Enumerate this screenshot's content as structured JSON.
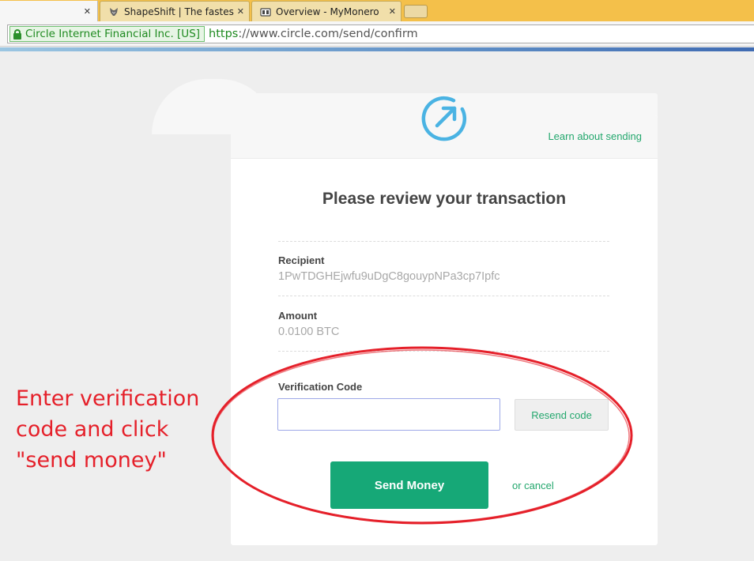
{
  "browser": {
    "tabs": [
      {
        "title": "",
        "active": true
      },
      {
        "title": "ShapeShift | The fastest wa",
        "active": false
      },
      {
        "title": "Overview - MyMonero",
        "active": false
      }
    ],
    "close_glyph": "✕",
    "ev_certificate": "Circle Internet Financial Inc. [US]",
    "url_scheme": "https",
    "url_rest": "://www.circle.com/send/confirm"
  },
  "page": {
    "learn_link": "Learn about sending",
    "title": "Please review your transaction",
    "recipient": {
      "label": "Recipient",
      "value": "1PwTDGHEjwfu9uDgC8gouypNPa3cp7Ipfc"
    },
    "amount": {
      "label": "Amount",
      "value": "0.0100 BTC"
    },
    "verification": {
      "label": "Verification Code",
      "value": "",
      "placeholder": ""
    },
    "resend_label": "Resend code",
    "send_label": "Send Money",
    "cancel_label": "or cancel"
  },
  "annotation": {
    "lines": [
      "Enter verification",
      "code and click",
      "\"send money\""
    ],
    "color": "#e5202a"
  },
  "colors": {
    "brand_green": "#16a877",
    "link_green": "#23a76d",
    "logo_blue": "#4ab3e3",
    "tabbar": "#f4c04a"
  }
}
